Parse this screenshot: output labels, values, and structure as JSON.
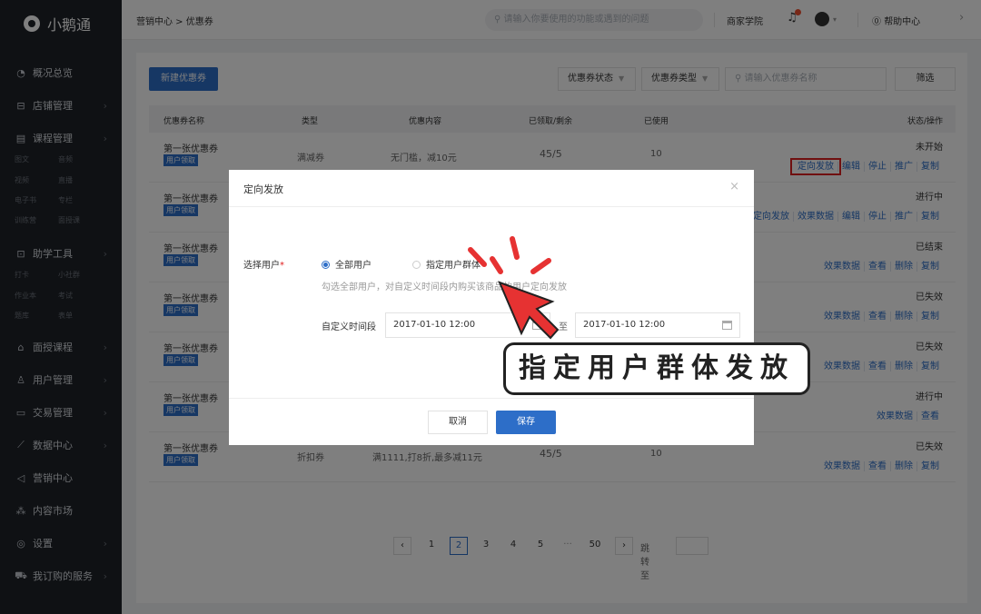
{
  "sidebar": {
    "logo": "小鹅通",
    "items": [
      {
        "label": "概况总览",
        "icon": "chart-pie-icon",
        "chevron": ""
      },
      {
        "label": "店铺管理",
        "icon": "store-icon",
        "chevron": "›"
      },
      {
        "label": "课程管理",
        "icon": "course-icon",
        "chevron": "›"
      },
      {
        "label": "助学工具",
        "icon": "toolbox-icon",
        "chevron": "›"
      },
      {
        "label": "面授课程",
        "icon": "classroom-icon",
        "chevron": "›"
      },
      {
        "label": "用户管理",
        "icon": "users-icon",
        "chevron": "›"
      },
      {
        "label": "交易管理",
        "icon": "wallet-icon",
        "chevron": "›"
      },
      {
        "label": "数据中心",
        "icon": "line-chart-icon",
        "chevron": "›"
      },
      {
        "label": "营销中心",
        "icon": "megaphone-icon",
        "chevron": ""
      },
      {
        "label": "内容市场",
        "icon": "network-icon",
        "chevron": ""
      },
      {
        "label": "设置",
        "icon": "settings-icon",
        "chevron": "›"
      },
      {
        "label": "我订购的服务",
        "icon": "cart-icon",
        "chevron": "›"
      }
    ],
    "course_sub": [
      [
        "图文",
        "音频"
      ],
      [
        "视频",
        "直播"
      ],
      [
        "电子书",
        "专栏"
      ],
      [
        "训练营",
        "面授课"
      ]
    ],
    "tools_sub": [
      [
        "打卡",
        "小社群"
      ],
      [
        "作业本",
        "考试"
      ],
      [
        "题库",
        "表单"
      ]
    ]
  },
  "topbar": {
    "breadcrumb": "营销中心 > 优惠券",
    "search_placeholder": "请输入你要使用的功能或遇到的问题",
    "merchant_school": "商家学院",
    "help": "帮助中心"
  },
  "toolbar": {
    "new_coupon": "新建优惠券",
    "status_select": "优惠券状态",
    "type_select": "优惠券类型",
    "search_placeholder": "请输入优惠券名称",
    "filter": "筛选"
  },
  "table": {
    "headers": [
      "优惠券名称",
      "类型",
      "优惠内容",
      "已领取/剩余",
      "已使用",
      "状态/操作"
    ],
    "rows": [
      {
        "name": "第一张优惠券",
        "badge": "用户领取",
        "type": "满减券",
        "content": "无门槛，减10元",
        "count": "45/5",
        "used": "10",
        "status": "未开始",
        "actions": [
          "定向发放",
          "编辑",
          "停止",
          "推广",
          "复制"
        ]
      },
      {
        "name": "第一张优惠券",
        "badge": "用户领取",
        "type": "",
        "content": "",
        "count": "",
        "used": "",
        "status": "进行中",
        "actions": [
          "定向发放",
          "效果数据",
          "编辑",
          "停止",
          "推广",
          "复制"
        ]
      },
      {
        "name": "第一张优惠券",
        "badge": "用户领取",
        "type": "",
        "content": "",
        "count": "",
        "used": "",
        "status": "已结束",
        "actions": [
          "效果数据",
          "查看",
          "删除",
          "复制"
        ]
      },
      {
        "name": "第一张优惠券",
        "badge": "用户领取",
        "type": "",
        "content": "",
        "count": "",
        "used": "",
        "status": "已失效",
        "actions": [
          "效果数据",
          "查看",
          "删除",
          "复制"
        ]
      },
      {
        "name": "第一张优惠券",
        "badge": "用户领取",
        "type": "",
        "content": "",
        "count": "",
        "used": "",
        "status": "已失效",
        "actions": [
          "效果数据",
          "查看",
          "删除",
          "复制"
        ]
      },
      {
        "name": "第一张优惠券",
        "badge": "用户领取",
        "type": "",
        "content": "",
        "count": "",
        "used": "",
        "status": "进行中",
        "actions": [
          "效果数据",
          "查看"
        ]
      },
      {
        "name": "第一张优惠券",
        "badge": "用户领取",
        "type": "折扣券",
        "content": "满1111,打8折,最多减11元",
        "count": "45/5",
        "used": "10",
        "status": "已失效",
        "actions": [
          "效果数据",
          "查看",
          "删除",
          "复制"
        ]
      }
    ]
  },
  "pagination": {
    "prev": "‹",
    "pages": [
      "1",
      "2",
      "3",
      "4",
      "5"
    ],
    "ellipsis": "···",
    "last": "50",
    "next": "›",
    "jump_label": "跳转至",
    "current": "2"
  },
  "modal": {
    "title": "定向发放",
    "select_user_label": "选择用户",
    "required_mark": "*",
    "option_all": "全部用户",
    "option_group": "指定用户群体",
    "hint": "勾选全部用户，对自定义时间段内购买该商品的用户定向发放",
    "time_label": "自定义时间段",
    "start_time": "2017-01-10  12:00",
    "to_label": "至",
    "end_time": "2017-01-10  12:00",
    "cancel": "取消",
    "save": "保存"
  },
  "annotation": {
    "callout": "指定用户群体发放"
  },
  "colors": {
    "sidebar_bg": "#1e2228",
    "primary": "#2d6ec8",
    "highlight": "#e02020",
    "cursor_red": "#e63232"
  }
}
